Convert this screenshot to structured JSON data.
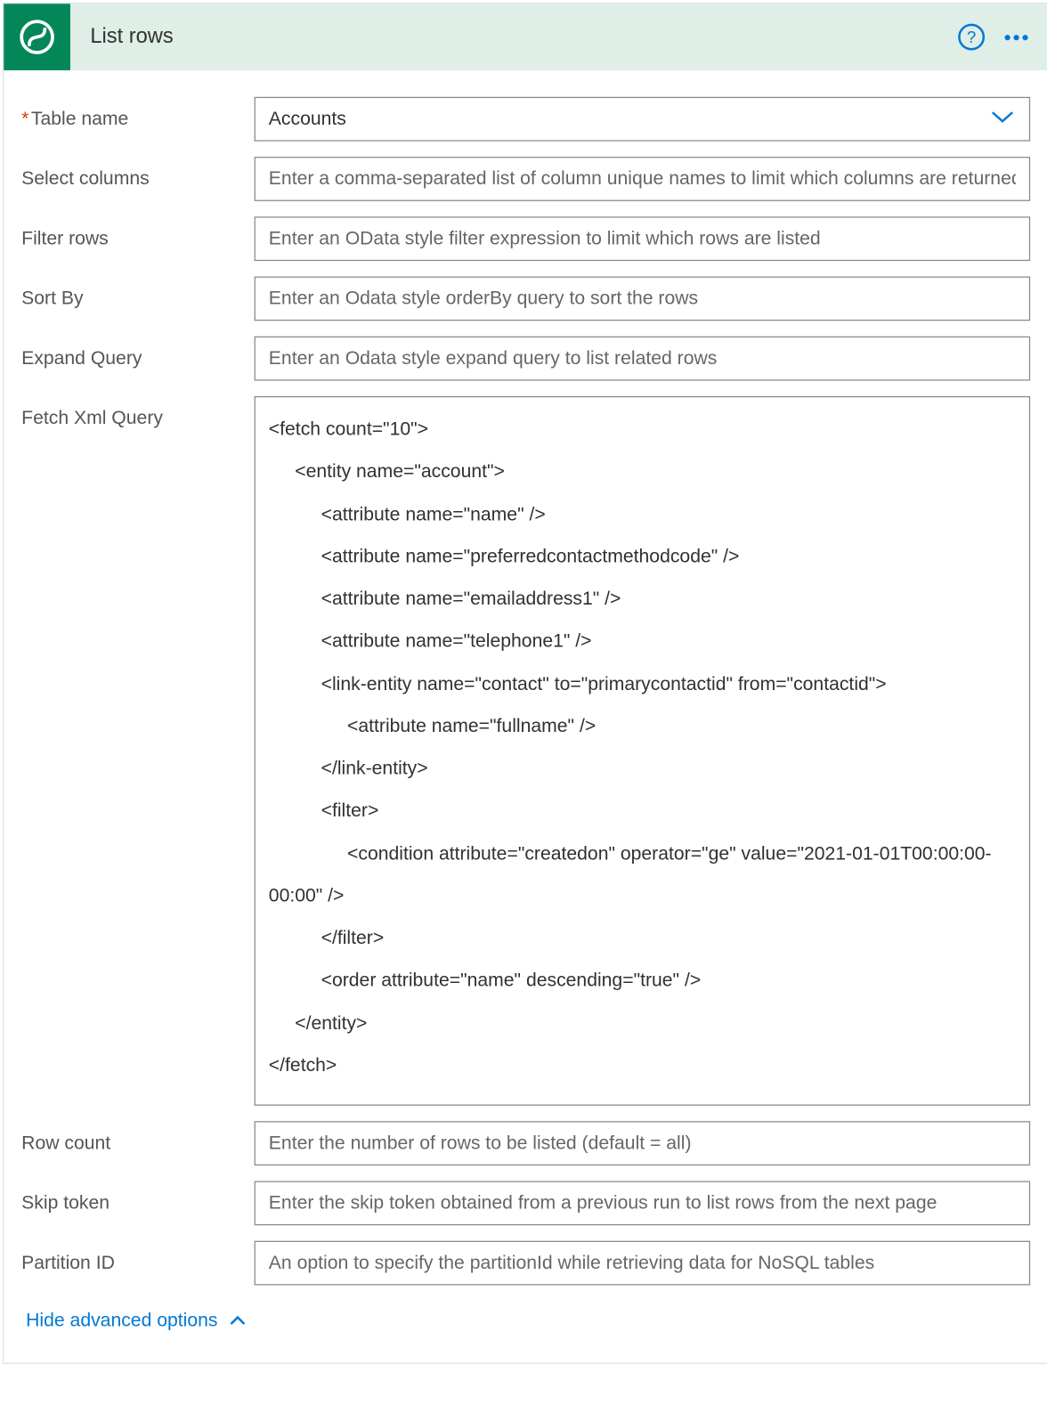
{
  "header": {
    "title": "List rows"
  },
  "fields": {
    "table_name": {
      "label": "Table name",
      "value": "Accounts",
      "required": true
    },
    "select_columns": {
      "label": "Select columns",
      "placeholder": "Enter a comma-separated list of column unique names to limit which columns are returned"
    },
    "filter_rows": {
      "label": "Filter rows",
      "placeholder": "Enter an OData style filter expression to limit which rows are listed"
    },
    "sort_by": {
      "label": "Sort By",
      "placeholder": "Enter an Odata style orderBy query to sort the rows"
    },
    "expand_query": {
      "label": "Expand Query",
      "placeholder": "Enter an Odata style expand query to list related rows"
    },
    "fetch_xml_query": {
      "label": "Fetch Xml Query",
      "value": "<fetch count=\"10\">\n     <entity name=\"account\">\n          <attribute name=\"name\" />\n          <attribute name=\"preferredcontactmethodcode\" />\n          <attribute name=\"emailaddress1\" />\n          <attribute name=\"telephone1\" />\n          <link-entity name=\"contact\" to=\"primarycontactid\" from=\"contactid\">\n               <attribute name=\"fullname\" />\n          </link-entity>\n          <filter>\n               <condition attribute=\"createdon\" operator=\"ge\" value=\"2021-01-01T00:00:00-00:00\" />\n          </filter>\n          <order attribute=\"name\" descending=\"true\" />\n     </entity>\n</fetch>"
    },
    "row_count": {
      "label": "Row count",
      "placeholder": "Enter the number of rows to be listed (default = all)"
    },
    "skip_token": {
      "label": "Skip token",
      "placeholder": "Enter the skip token obtained from a previous run to list rows from the next page"
    },
    "partition_id": {
      "label": "Partition ID",
      "placeholder": "An option to specify the partitionId while retrieving data for NoSQL tables"
    }
  },
  "footer": {
    "toggle_label": "Hide advanced options"
  }
}
